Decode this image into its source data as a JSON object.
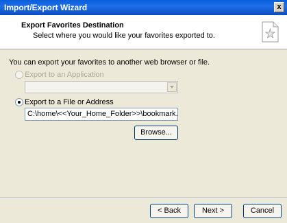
{
  "window": {
    "title": "Import/Export Wizard",
    "close_glyph": "x"
  },
  "header": {
    "title": "Export Favorites Destination",
    "subtitle": "Select where you would like your favorites exported to.",
    "icon": "favorites-document-icon"
  },
  "intro_text": "You can export your favorites to another web browser or file.",
  "options": {
    "application": {
      "label": "Export to an Application",
      "selected": false,
      "enabled": false,
      "combo_value": ""
    },
    "file": {
      "label": "Export to a File or Address",
      "selected": true,
      "enabled": true,
      "path_value": "C:\\home\\<<Your_Home_Folder>>\\bookmark.htm"
    }
  },
  "buttons": {
    "browse": "Browse...",
    "back": "< Back",
    "next": "Next >",
    "cancel": "Cancel"
  }
}
